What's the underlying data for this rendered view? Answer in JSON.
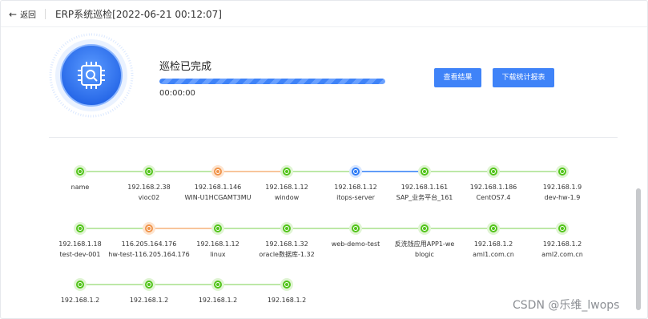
{
  "header": {
    "back_label": "返回",
    "title": "ERP系统巡检[2022-06-21 00:12:07]"
  },
  "inspection": {
    "status": "巡检已完成",
    "progress_percent": 100,
    "elapsed": "00:00:00",
    "badge_icon": "chip-search-icon"
  },
  "actions": {
    "view_results": "查看结果",
    "download_report": "下载统计报表"
  },
  "colors": {
    "accent": "#3f83f8",
    "ok": "#52c41a",
    "warn": "#f0944a",
    "current": "#2f7cf6"
  },
  "flow": {
    "rows": [
      [
        {
          "label": "name",
          "state": "ok"
        },
        {
          "label": "192.168.2.38\n\nvioc02",
          "state": "ok"
        },
        {
          "label": "192.168.1.146\n\nWIN-U1HCGAMT3MU",
          "state": "warn"
        },
        {
          "label": "192.168.1.12\n\nwindow",
          "state": "ok"
        },
        {
          "label": "192.168.1.12\n\nitops-server",
          "state": "current"
        },
        {
          "label": "192.168.1.161\n\nSAP_业务平台_161",
          "state": "ok"
        },
        {
          "label": "192.168.1.186\n\nCentOS7.4",
          "state": "ok"
        },
        {
          "label": "192.168.1.9\n\ndev-hw-1.9",
          "state": "ok"
        }
      ],
      [
        {
          "label": "192.168.1.18\n\ntest-dev-001",
          "state": "ok"
        },
        {
          "label": "116.205.164.176\n\nhw-test-116.205.164.176",
          "state": "warn"
        },
        {
          "label": "192.168.1.12\n\nlinux",
          "state": "ok"
        },
        {
          "label": "192.168.1.32\n\noracle数据库-1.32",
          "state": "ok"
        },
        {
          "label": "web-demo-test",
          "state": "ok"
        },
        {
          "label": "反洗钱应用APP1-we\n\nblogic",
          "state": "ok"
        },
        {
          "label": "192.168.1.2\n\naml1.com.cn",
          "state": "ok"
        },
        {
          "label": "192.168.1.2\n\naml2.com.cn",
          "state": "ok"
        }
      ],
      [
        {
          "label": "192.168.1.2",
          "state": "ok"
        },
        {
          "label": "192.168.1.2",
          "state": "ok"
        },
        {
          "label": "192.168.1.2",
          "state": "ok"
        },
        {
          "label": "192.168.1.2",
          "state": "ok"
        }
      ]
    ]
  },
  "watermark": "CSDN @乐维_lwops"
}
